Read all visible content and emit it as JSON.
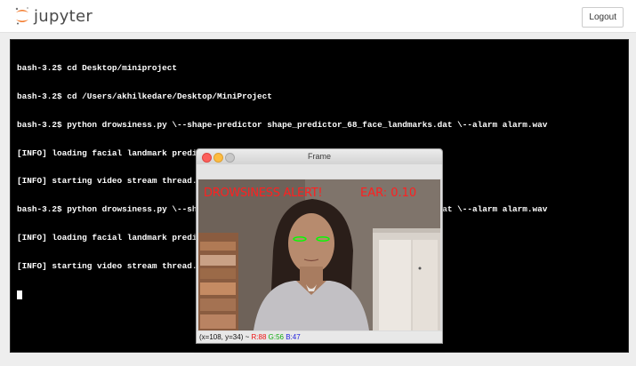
{
  "header": {
    "logo_text": "jupyter",
    "logout_label": "Logout"
  },
  "terminal": {
    "lines": [
      "bash-3.2$ cd Desktop/miniproject",
      "bash-3.2$ cd /Users/akhilkedare/Desktop/MiniProject",
      "bash-3.2$ python drowsiness.py \\--shape-predictor shape_predictor_68_face_landmarks.dat \\--alarm alarm.wav",
      "[INFO] loading facial landmark predictor...",
      "[INFO] starting video stream thread...",
      "bash-3.2$ python drowsiness.py \\--shape-predictor shape_predictor_68_face_landmarks.dat \\--alarm alarm.wav",
      "[INFO] loading facial landmark predictor...",
      "[INFO] starting video stream thread..."
    ]
  },
  "frame_window": {
    "title": "Frame",
    "alert_text": "DROWSINESS ALERT!",
    "ear_text": "EAR: 0.10",
    "status": {
      "coords": "(x=108, y=34) ~",
      "r": "R:88",
      "g": "G:56",
      "b": "B:47"
    }
  },
  "colors": {
    "terminal_bg": "#000000",
    "alert_red": "#ff2020",
    "landmark_green": "#00ff00",
    "jupyter_orange": "#f37726"
  }
}
